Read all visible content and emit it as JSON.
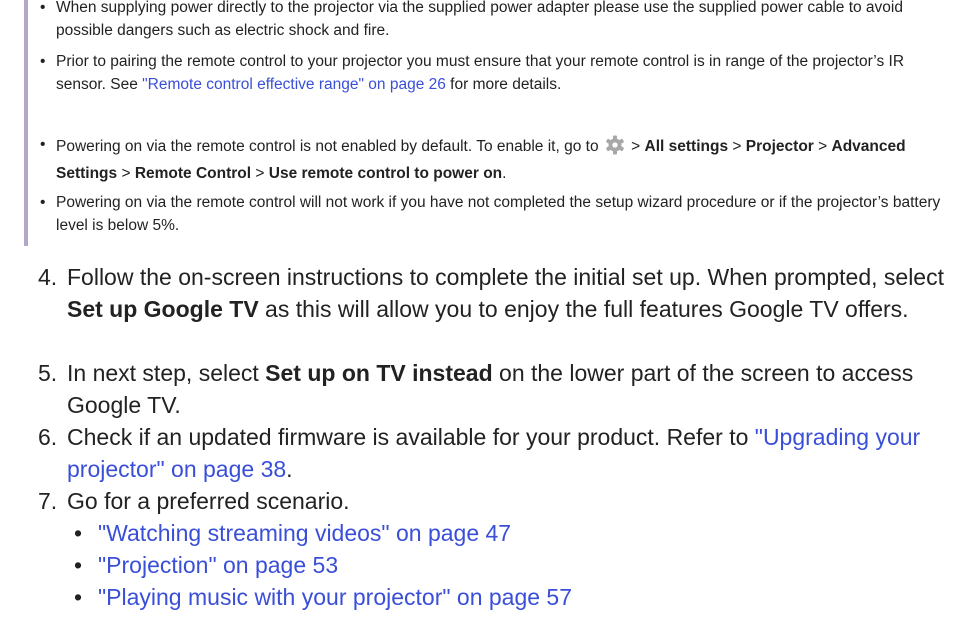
{
  "note": {
    "bullet_char": "•",
    "item1": "When supplying power directly to the projector via the supplied power adapter please use the supplied power cable to avoid possible dangers such as electric shock and fire.",
    "item2": {
      "before": "Prior to pairing the remote control to your projector you must ensure that your remote control is in range of the projector’s IR sensor. See ",
      "link": "\"Remote control effective range\" on page 26",
      "after": " for more details."
    },
    "item3": {
      "before": "Powering on via the remote control is not enabled by default. To enable it, go to ",
      "icon": "gear-icon",
      "sep": " > ",
      "all_settings": "All settings",
      "projector": "Projector",
      "advanced_settings": "Advanced Settings",
      "remote_control": "Remote Control",
      "use_remote": "Use remote control to power on",
      "end": "."
    },
    "item4": "Powering on via the remote control will not work if you have not completed the setup wizard procedure or if the projector’s battery level is below 5%."
  },
  "steps": {
    "s4": {
      "num": "4.",
      "before": "Follow the on-screen instructions to complete the initial set up. When prompted, select ",
      "bold": "Set up Google TV",
      "after": " as this will allow you to enjoy the full features Google TV offers."
    },
    "s5": {
      "num": "5.",
      "before": "In next step, select ",
      "bold": "Set up on TV instead",
      "after": " on the lower part of the screen to access Google TV."
    },
    "s6": {
      "num": "6.",
      "before": "Check if an updated firmware is available for your product. Refer to ",
      "link": "\"Upgrading your projector\" on page 38",
      "after": "."
    },
    "s7": {
      "num": "7.",
      "text": "Go for a preferred scenario.",
      "links": [
        "\"Watching streaming videos\" on page 47",
        "\"Projection\" on page 53",
        "\"Playing music with your projector\" on page 57"
      ]
    }
  },
  "colors": {
    "link": "#3a4fd7",
    "note_bar": "#b3a6c9",
    "gear": "#a8a8a8"
  }
}
